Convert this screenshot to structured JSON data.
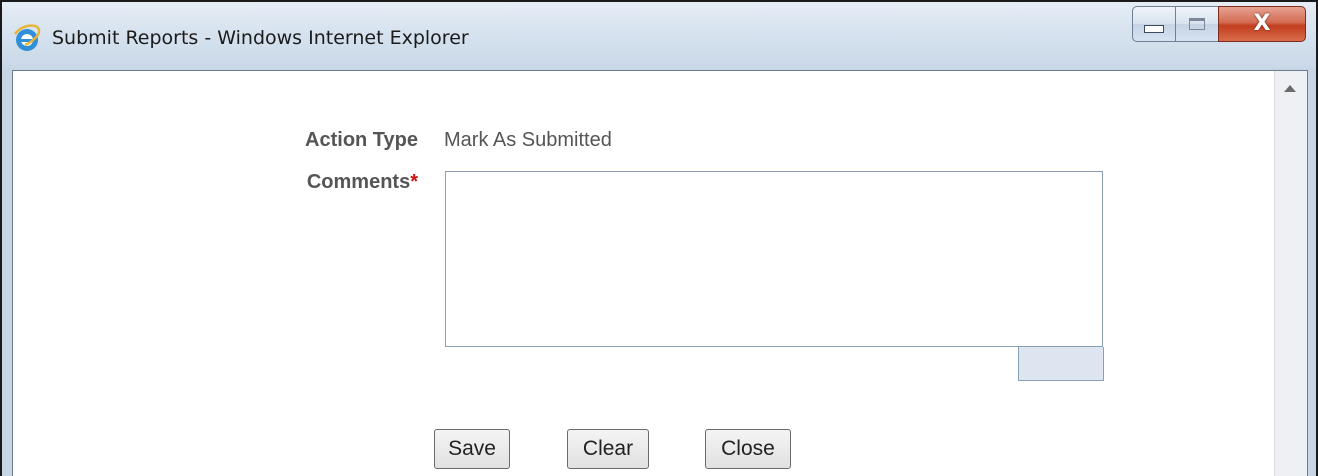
{
  "window": {
    "title": "Submit Reports - Windows Internet Explorer",
    "icon": "ie-logo-icon",
    "controls": {
      "minimize_icon": "minimize-icon",
      "maximize_icon": "maximize-icon",
      "close_label": "X"
    }
  },
  "form": {
    "action_type_label": "Action Type",
    "action_type_value": "Mark As Submitted",
    "comments_label": "Comments",
    "comments_required_marker": "*",
    "comments_value": ""
  },
  "buttons": {
    "save_label": "Save",
    "clear_label": "Clear",
    "close_label": "Close"
  },
  "colors": {
    "required": "#cc1111",
    "label_text": "#555555",
    "field_border": "#8aa0b8"
  }
}
